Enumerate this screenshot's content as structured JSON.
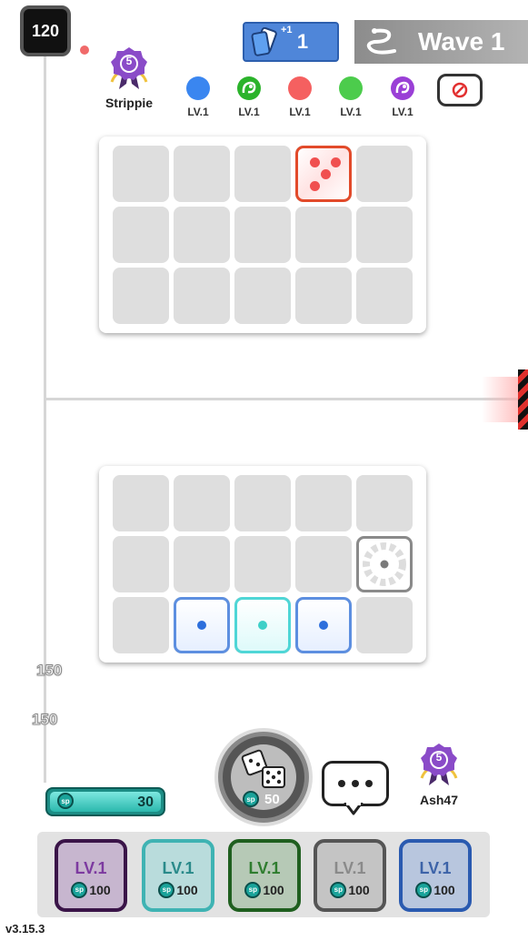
{
  "timer": "120",
  "cards": {
    "count": "1",
    "bonus": "+1"
  },
  "wave": {
    "label": "Wave 1"
  },
  "opponent": {
    "name": "Strippie",
    "rank": "5"
  },
  "opponent_deck": [
    {
      "level": "LV.1",
      "color": "#3a86f0",
      "icon": "blue-dot-icon"
    },
    {
      "level": "LV.1",
      "color": "#2bb32b",
      "icon": "green-dragon-icon"
    },
    {
      "level": "LV.1",
      "color": "#f56060",
      "icon": "red-dot-icon"
    },
    {
      "level": "LV.1",
      "color": "#4ccc4c",
      "icon": "green-dot-icon"
    },
    {
      "level": "LV.1",
      "color": "#9a3fd6",
      "icon": "purple-dragon-icon"
    }
  ],
  "player": {
    "name": "Ash47",
    "rank": "5",
    "sp": "30"
  },
  "floating_numbers": [
    "150",
    "150"
  ],
  "roll": {
    "cost": "50"
  },
  "upgrades": [
    {
      "level": "LV.1",
      "cost": "100",
      "color": "#8a3ea8",
      "border": "#3a1448",
      "icon": "dark-dragon-icon"
    },
    {
      "level": "LV.1",
      "cost": "100",
      "color": "#3fb3b3",
      "border": "#1b6f6f",
      "icon": "ice-icon"
    },
    {
      "level": "LV.1",
      "cost": "100",
      "color": "#2f7d2f",
      "border": "#154c15",
      "icon": "vine-icon"
    },
    {
      "level": "LV.1",
      "cost": "100",
      "color": "#9a9a9a",
      "border": "#555555",
      "icon": "gear-icon"
    },
    {
      "level": "LV.1",
      "cost": "100",
      "color": "#5579b8",
      "border": "#2a4a86",
      "icon": "wind-icon"
    }
  ],
  "sp_symbol": "sp",
  "version": "v3.15.3"
}
